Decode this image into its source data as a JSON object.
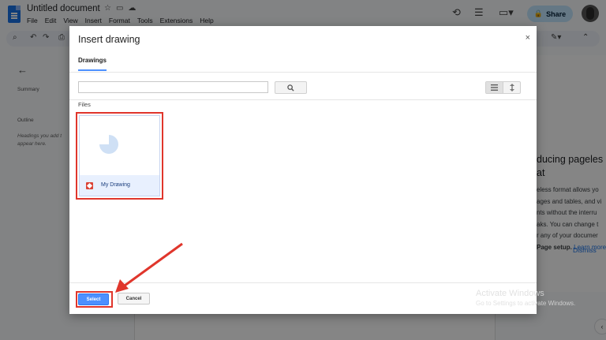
{
  "app": {
    "doc_title": "Untitled document",
    "menu": [
      "File",
      "Edit",
      "View",
      "Insert",
      "Format",
      "Tools",
      "Extensions",
      "Help"
    ],
    "share_label": "Share"
  },
  "left_panel": {
    "summary_label": "Summary",
    "outline_label": "Outline",
    "outline_hint_line1": "Headings you add t",
    "outline_hint_line2": "appear here."
  },
  "right_card": {
    "title_line1": "ducing pageles",
    "title_line2": "at",
    "body_line1": "eless format allows yo",
    "body_line2": "ages and tables, and vi",
    "body_line3": "nts without the interru",
    "body_line4": "aks. You can change t",
    "body_line5": "r any of your documer",
    "body_line6_bold": "Page setup.",
    "body_line6_link": "Learn more",
    "dismiss_label": "Dismiss"
  },
  "dialog": {
    "title": "Insert drawing",
    "close_glyph": "×",
    "tab_label": "Drawings",
    "search_placeholder": "",
    "files_label": "Files",
    "files": [
      {
        "name": "My Drawing"
      }
    ],
    "select_label": "Select",
    "cancel_label": "Cancel"
  },
  "watermark": {
    "line1": "Activate Windows",
    "line2": "Go to Settings to activate Windows."
  },
  "colors": {
    "highlight": "#e0362c",
    "primary_button": "#4d90fe",
    "selected_file_bg": "#e8f0fe"
  }
}
